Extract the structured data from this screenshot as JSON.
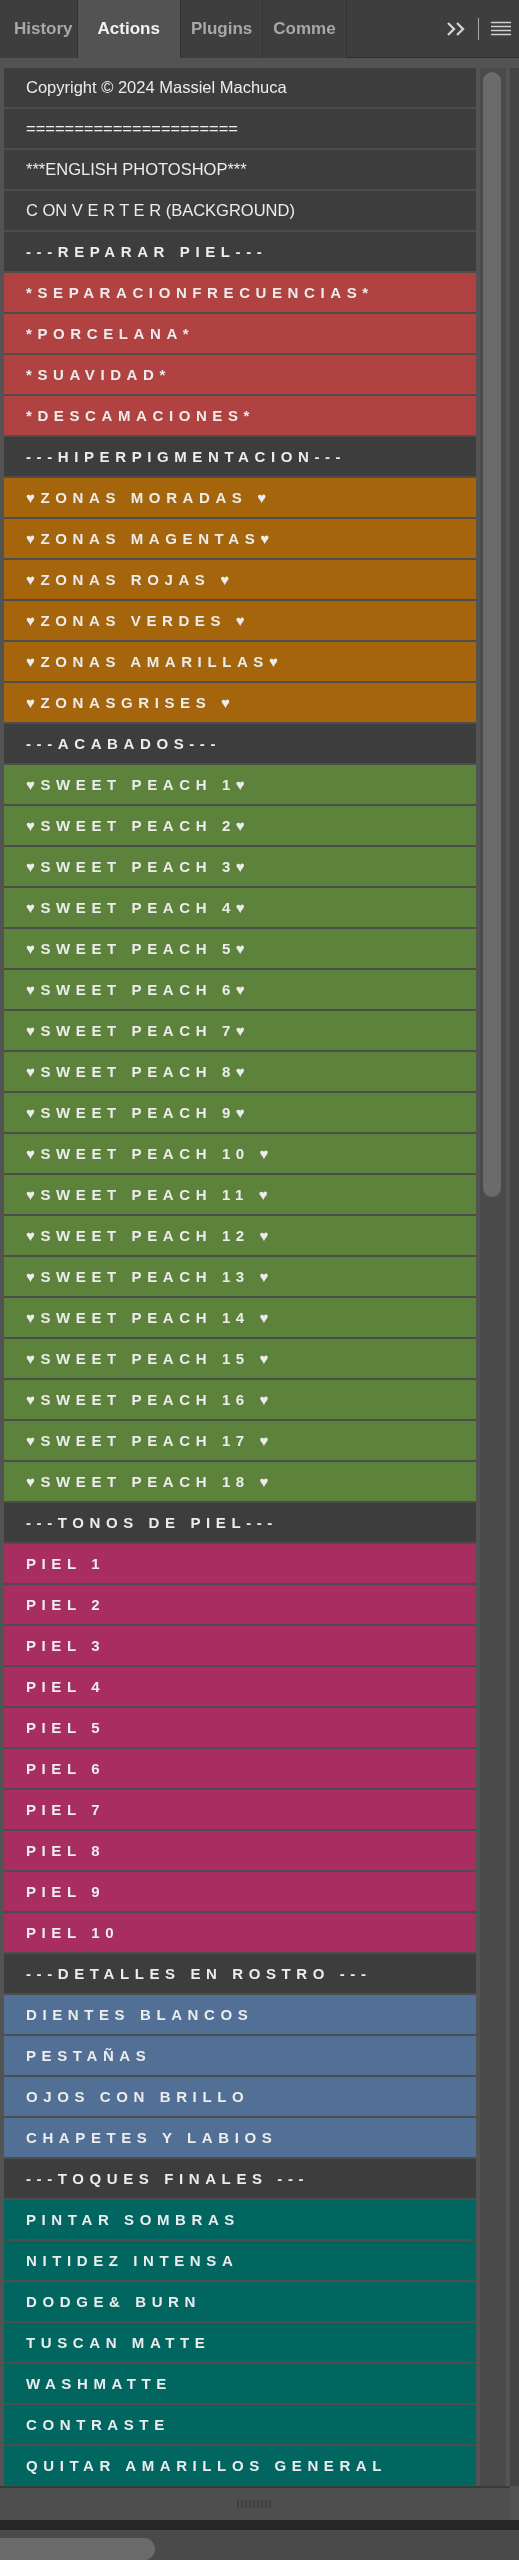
{
  "tabs": [
    {
      "label": "History",
      "selected": false
    },
    {
      "label": "Actions",
      "selected": true
    },
    {
      "label": "Plugins",
      "selected": false
    },
    {
      "label": "Comme",
      "selected": false
    }
  ],
  "actions": [
    {
      "label": "Copyright © 2024 Massiel Machuca",
      "kind": "plain",
      "color": "#3d3d3d"
    },
    {
      "label": "======================",
      "kind": "plain",
      "color": "#3d3d3d"
    },
    {
      "label": "***ENGLISH PHOTOSHOP***",
      "kind": "plain",
      "color": "#3d3d3d"
    },
    {
      "label": "C ON V E R T E R (BACKGROUND)",
      "kind": "plain",
      "color": "#3d3d3d"
    },
    {
      "label": "---REPARAR PIEL---",
      "kind": "spaced",
      "color": "#3d3d3d"
    },
    {
      "label": "*SEPARACIONFRECUENCIAS*",
      "kind": "spaced",
      "color": "#b04242"
    },
    {
      "label": "*PORCELANA*",
      "kind": "spaced",
      "color": "#b04242"
    },
    {
      "label": "*SUAVIDAD*",
      "kind": "spaced",
      "color": "#b04242"
    },
    {
      "label": "*DESCAMACIONES*",
      "kind": "spaced",
      "color": "#b04242"
    },
    {
      "label": "---HIPERPIGMENTACION---",
      "kind": "spaced",
      "color": "#3d3d3d"
    },
    {
      "label": "♥ZONAS MORADAS ♥",
      "kind": "spaced",
      "color": "#a5650c"
    },
    {
      "label": "♥ZONAS MAGENTAS♥",
      "kind": "spaced",
      "color": "#a5650c"
    },
    {
      "label": "♥ZONAS ROJAS ♥",
      "kind": "spaced",
      "color": "#a5650c"
    },
    {
      "label": "♥ZONAS VERDES ♥",
      "kind": "spaced",
      "color": "#a5650c"
    },
    {
      "label": "♥ZONAS AMARILLAS♥",
      "kind": "spaced",
      "color": "#a5650c"
    },
    {
      "label": "♥ZONASGRISES ♥",
      "kind": "spaced",
      "color": "#a5650c"
    },
    {
      "label": "---ACABADOS---",
      "kind": "spaced",
      "color": "#3d3d3d"
    },
    {
      "label": "♥SWEET PEACH 1♥",
      "kind": "spaced",
      "color": "#5d823c"
    },
    {
      "label": "♥SWEET PEACH 2♥",
      "kind": "spaced",
      "color": "#5d823c"
    },
    {
      "label": "♥SWEET PEACH 3♥",
      "kind": "spaced",
      "color": "#5d823c"
    },
    {
      "label": "♥SWEET PEACH 4♥",
      "kind": "spaced",
      "color": "#5d823c"
    },
    {
      "label": "♥SWEET PEACH 5♥",
      "kind": "spaced",
      "color": "#5d823c"
    },
    {
      "label": "♥SWEET PEACH 6♥",
      "kind": "spaced",
      "color": "#5d823c"
    },
    {
      "label": "♥SWEET PEACH 7♥",
      "kind": "spaced",
      "color": "#5d823c"
    },
    {
      "label": "♥SWEET PEACH 8♥",
      "kind": "spaced",
      "color": "#5d823c"
    },
    {
      "label": "♥SWEET PEACH 9♥",
      "kind": "spaced",
      "color": "#5d823c"
    },
    {
      "label": "♥SWEET PEACH 10 ♥",
      "kind": "spaced",
      "color": "#5d823c"
    },
    {
      "label": "♥SWEET PEACH 11 ♥",
      "kind": "spaced",
      "color": "#5d823c"
    },
    {
      "label": "♥SWEET PEACH 12 ♥",
      "kind": "spaced",
      "color": "#5d823c"
    },
    {
      "label": "♥SWEET PEACH 13 ♥",
      "kind": "spaced",
      "color": "#5d823c"
    },
    {
      "label": "♥SWEET PEACH 14 ♥",
      "kind": "spaced",
      "color": "#5d823c"
    },
    {
      "label": "♥SWEET PEACH 15 ♥",
      "kind": "spaced",
      "color": "#5d823c"
    },
    {
      "label": "♥SWEET PEACH 16 ♥",
      "kind": "spaced",
      "color": "#5d823c"
    },
    {
      "label": "♥SWEET PEACH 17 ♥",
      "kind": "spaced",
      "color": "#5d823c"
    },
    {
      "label": "♥SWEET PEACH 18 ♥",
      "kind": "spaced",
      "color": "#5d823c"
    },
    {
      "label": "---TONOS DE PIEL---",
      "kind": "spaced",
      "color": "#3d3d3d"
    },
    {
      "label": "PIEL 1",
      "kind": "spaced",
      "color": "#a82e62"
    },
    {
      "label": "PIEL 2",
      "kind": "spaced",
      "color": "#a82e62"
    },
    {
      "label": "PIEL 3",
      "kind": "spaced",
      "color": "#a82e62"
    },
    {
      "label": "PIEL 4",
      "kind": "spaced",
      "color": "#a82e62"
    },
    {
      "label": "PIEL 5",
      "kind": "spaced",
      "color": "#a82e62"
    },
    {
      "label": "PIEL 6",
      "kind": "spaced",
      "color": "#a82e62"
    },
    {
      "label": "PIEL 7",
      "kind": "spaced",
      "color": "#a82e62"
    },
    {
      "label": "PIEL 8",
      "kind": "spaced",
      "color": "#a82e62"
    },
    {
      "label": "PIEL 9",
      "kind": "spaced",
      "color": "#a82e62"
    },
    {
      "label": "PIEL 10",
      "kind": "spaced",
      "color": "#a82e62"
    },
    {
      "label": "---DETALLES EN ROSTRO ---",
      "kind": "spaced",
      "color": "#3d3d3d"
    },
    {
      "label": "DIENTES BLANCOS",
      "kind": "spaced",
      "color": "#527096"
    },
    {
      "label": "PESTAÑAS",
      "kind": "spaced",
      "color": "#527096"
    },
    {
      "label": "OJOS CON BRILLO",
      "kind": "spaced",
      "color": "#527096"
    },
    {
      "label": "CHAPETES Y LABIOS",
      "kind": "spaced",
      "color": "#527096"
    },
    {
      "label": "---TOQUES FINALES ---",
      "kind": "spaced",
      "color": "#3d3d3d"
    },
    {
      "label": "PINTAR SOMBRAS",
      "kind": "spaced",
      "color": "#016660"
    },
    {
      "label": "NITIDEZ INTENSA",
      "kind": "spaced",
      "color": "#016660"
    },
    {
      "label": "DODGE& BURN",
      "kind": "spaced",
      "color": "#016660"
    },
    {
      "label": "TUSCAN MATTE",
      "kind": "spaced",
      "color": "#016660"
    },
    {
      "label": "WASHMATTE",
      "kind": "spaced",
      "color": "#016660"
    },
    {
      "label": "CONTRASTE",
      "kind": "spaced",
      "color": "#016660"
    },
    {
      "label": "QUITAR AMARILLOS GENERAL",
      "kind": "spaced",
      "color": "#016660"
    }
  ]
}
